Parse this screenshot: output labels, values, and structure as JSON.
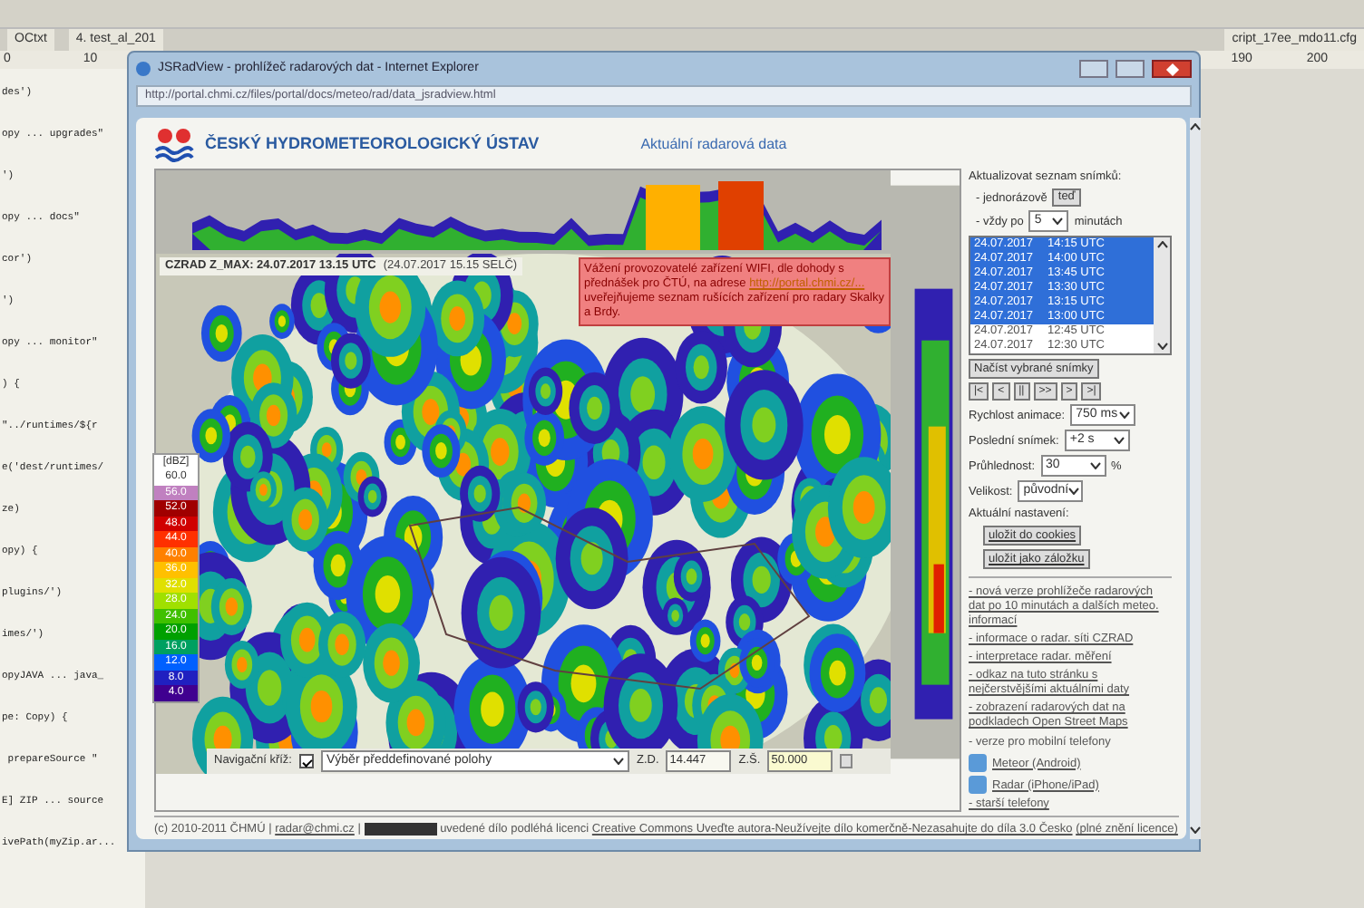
{
  "background_editor": {
    "tabs": [
      {
        "label": "OCtxt"
      },
      {
        "label": "4. test_al_201"
      },
      {
        "label": "cript_17ee_mdo11.cfg"
      }
    ],
    "ruler": [
      "0",
      "10",
      "190",
      "200"
    ],
    "code_lines": [
      "des')",
      "opy ... upgrades\"",
      "')",
      "opy ... docs\"",
      "cor')",
      "')",
      "opy ... monitor\"",
      ") {",
      "\"../runtimes/${r",
      "e('dest/runtimes/",
      "ze)",
      "opy) {",
      "plugins/')",
      "imes/')",
      "opyJAVA ... java_",
      "pe: Copy) {",
      " prepareSource \"",
      "E] ZIP ... source",
      "ivePath(myZip.ar..."
    ]
  },
  "window": {
    "title": "JSRadView - prohlížeč radarových dat - Internet Explorer",
    "url": "http://portal.chmi.cz/files/portal/docs/meteo/rad/data_jsradview.html"
  },
  "header": {
    "organization": "ČESKÝ HYDROMETEOROLOGICKÝ ÚSTAV",
    "page_title": "Aktuální radarová data"
  },
  "map": {
    "caption": "CZRAD Z_MAX: 24.07.2017 13.15 UTC",
    "caption_local": "(24.07.2017 15.15 SELČ)",
    "notice": {
      "before": "Vážení provozovatelé zařízení WIFI, dle dohody s přednášek pro ČTÚ, na adrese",
      "link": "http://portal.chmi.cz/...",
      "after": "uveřejňujeme seznam rušících zařízení pro radary Skalky a Brdy."
    },
    "legend": {
      "unit": "[dBZ]",
      "levels": [
        {
          "label": "60.0",
          "color": "#ffffff"
        },
        {
          "label": "56.0",
          "color": "#c080c0"
        },
        {
          "label": "52.0",
          "color": "#a00000"
        },
        {
          "label": "48.0",
          "color": "#d00000"
        },
        {
          "label": "44.0",
          "color": "#ff3000"
        },
        {
          "label": "40.0",
          "color": "#ff8000"
        },
        {
          "label": "36.0",
          "color": "#ffc000"
        },
        {
          "label": "32.0",
          "color": "#e0e000"
        },
        {
          "label": "28.0",
          "color": "#a0e000"
        },
        {
          "label": "24.0",
          "color": "#40c000"
        },
        {
          "label": "20.0",
          "color": "#00a000"
        },
        {
          "label": "16.0",
          "color": "#00a060"
        },
        {
          "label": "12.0",
          "color": "#0060ff"
        },
        {
          "label": "8.0",
          "color": "#2020c0"
        },
        {
          "label": "4.0",
          "color": "#400090"
        }
      ]
    },
    "nav_cross": {
      "label": "Navigační kříž:",
      "checked": true
    },
    "position_select": "Výběr předdefinované polohy",
    "lon_label": "Z.D.",
    "lon": "14.447",
    "lat_label": "Z.Š.",
    "lat": "50.000"
  },
  "panel": {
    "refresh_label": "Aktualizovat seznam snímků:",
    "once_label": "- jednorázově",
    "once_button": "teď",
    "every_label": "- vždy po",
    "every_value": "5",
    "every_unit": "minutách",
    "frames": [
      {
        "date": "24.07.2017",
        "time": "14:15 UTC",
        "selected": true
      },
      {
        "date": "24.07.2017",
        "time": "14:00 UTC",
        "selected": true
      },
      {
        "date": "24.07.2017",
        "time": "13:45 UTC",
        "selected": true
      },
      {
        "date": "24.07.2017",
        "time": "13:30 UTC",
        "selected": true
      },
      {
        "date": "24.07.2017",
        "time": "13:15 UTC",
        "selected": true
      },
      {
        "date": "24.07.2017",
        "time": "13:00 UTC",
        "selected": true
      },
      {
        "date": "24.07.2017",
        "time": "12:45 UTC",
        "selected": false
      },
      {
        "date": "24.07.2017",
        "time": "12:30 UTC",
        "selected": false
      }
    ],
    "load_button": "Načíst vybrané snímky",
    "playback": [
      "|<",
      "<",
      "||",
      ">>",
      ">",
      ">|"
    ],
    "settings": [
      {
        "label": "Rychlost animace:",
        "value": "750 ms"
      },
      {
        "label": "Poslední snímek:",
        "value": "+2 s"
      },
      {
        "label": "Průhlednost:",
        "value": "30",
        "unit": "%"
      },
      {
        "label": "Velikost:",
        "value": "původní"
      }
    ],
    "current_label": "Aktuální nastavení:",
    "save_buttons": [
      "uložit do cookies",
      "uložit jako záložku"
    ],
    "links": [
      {
        "kind": "link",
        "text": "- nová verze prohlížeče radarových dat po 10 minutách a dalších meteo. informací"
      },
      {
        "kind": "link",
        "text": "- informace o radar. síti CZRAD"
      },
      {
        "kind": "link",
        "text": "- interpretace radar. měření"
      },
      {
        "kind": "link",
        "text": "- odkaz na tuto stránku s nejčerstvějšími aktuálními daty"
      },
      {
        "kind": "link",
        "text": "- zobrazení radarových dat na podkladech Open Street Maps"
      },
      {
        "kind": "text",
        "text": "- verze pro mobilní telefony"
      },
      {
        "kind": "app",
        "text": "Meteor (Android)"
      },
      {
        "kind": "app",
        "text": "Radar (iPhone/iPad)"
      },
      {
        "kind": "link",
        "text": "- starší telefony"
      }
    ]
  },
  "footer": {
    "copyright": "(c) 2010-2011 ČHMÚ |",
    "email": "radar@chmi.cz",
    "sep": "|",
    "license_text": "uvedené dílo podléhá licenci",
    "license_link": "Creative Commons Uveďte autora-Neužívejte dílo komerčně-Nezasahujte do díla 3.0 Česko",
    "full_link": "(plné znění licence)"
  }
}
